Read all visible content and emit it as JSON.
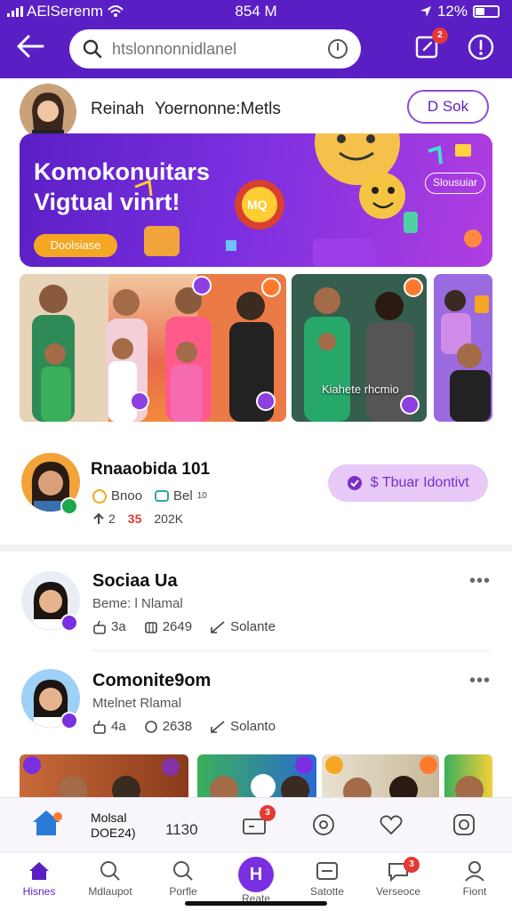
{
  "status_bar": {
    "carrier": "AElSerenm",
    "time": "854 M",
    "battery": "12%"
  },
  "header": {
    "search_placeholder": "htslonnonnidlanel",
    "compose_badge": "2"
  },
  "profile": {
    "name": "Reinah",
    "subtitle": "Yoernonne:Metls",
    "button": "D Sok"
  },
  "banner": {
    "title": "Komokonuitars Vigtual vinrt!",
    "cta": "Doolsiase",
    "tag": "Slousuiar",
    "center_text": "MQ"
  },
  "photos": {
    "caption": "Kiahete rhcmio"
  },
  "featured": {
    "name": "Rnaaobida 101",
    "meta_a": "Bnoo",
    "meta_b": "Bel",
    "meta_b_sup": "10",
    "stat_a": "2",
    "stat_hot": "35",
    "stat_b": "202K",
    "button": "$ Tbuar Idontivt"
  },
  "list": [
    {
      "name": "Sociaa Ua",
      "sub": "Beme: l Nlamal",
      "likes": "3a",
      "views": "2649",
      "action": "Solante"
    },
    {
      "name": "Comonite9om",
      "sub": "Mtelnet Rlamal",
      "likes": "4a",
      "views": "2638",
      "action": "Solanto"
    }
  ],
  "actionbar": {
    "line1": "Molsal",
    "line2": "DOE24)",
    "count": "1130",
    "badge": "3"
  },
  "nav": [
    {
      "label": "Hisnes",
      "active": true
    },
    {
      "label": "Mdlaupot"
    },
    {
      "label": "Porfle"
    },
    {
      "label": "Reate"
    },
    {
      "label": "Satotte"
    },
    {
      "label": "Verseoce",
      "badge": "3"
    },
    {
      "label": "Fiont"
    }
  ],
  "colors": {
    "brand": "#5a1fc4",
    "accent": "#7a2fe0",
    "badge": "#e53935",
    "pill": "#e7c8f7"
  }
}
